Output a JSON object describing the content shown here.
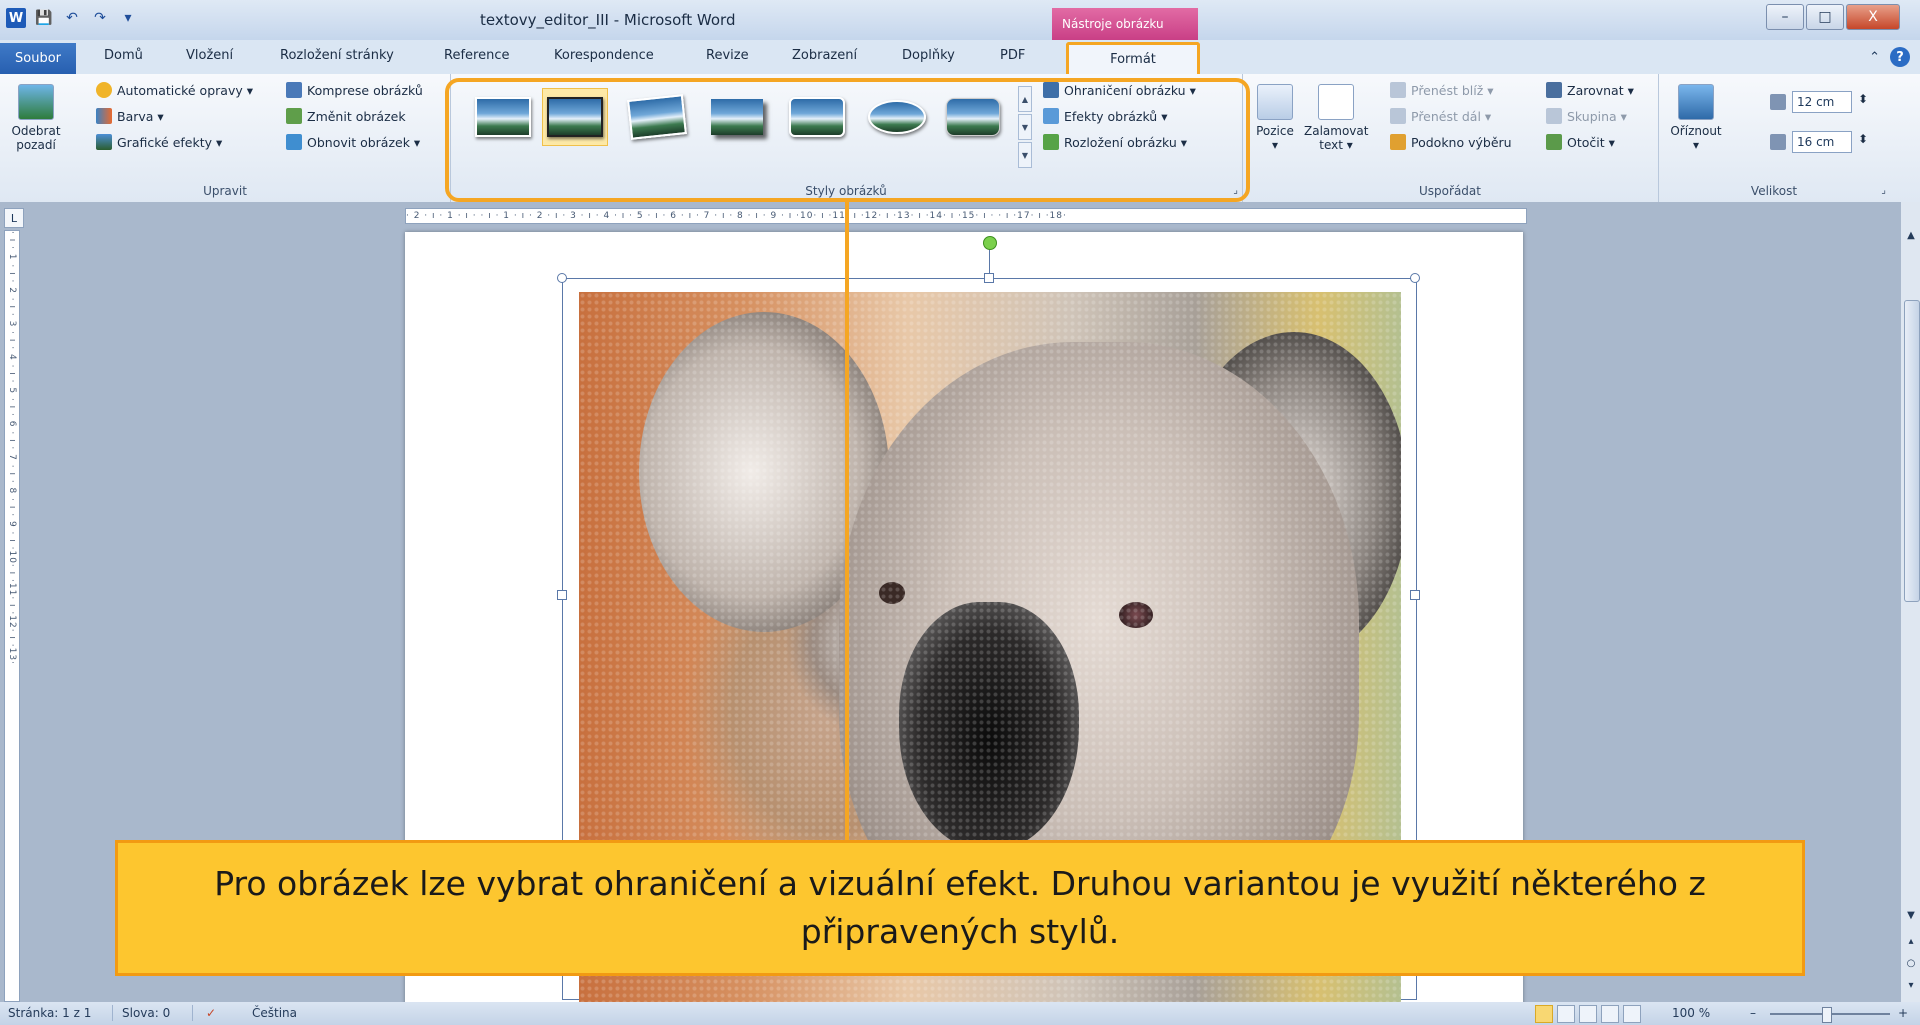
{
  "window": {
    "title": "textovy_editor_III - Microsoft Word",
    "context_group": "Nástroje obrázku",
    "controls": {
      "minimize": "–",
      "maximize": "□",
      "close": "X"
    }
  },
  "qat": {
    "app_icon": "W",
    "save": "💾",
    "undo": "↶",
    "redo": "↷",
    "customize": "▾"
  },
  "tabs": {
    "file": "Soubor",
    "items": [
      "Domů",
      "Vložení",
      "Rozložení stránky",
      "Reference",
      "Korespondence",
      "Revize",
      "Zobrazení",
      "Doplňky",
      "PDF"
    ],
    "active": "Formát",
    "minimize": "⌃",
    "help": "?"
  },
  "ribbon": {
    "adjust": {
      "title": "Upravit",
      "remove_bg": [
        "Odebrat",
        "pozadí"
      ],
      "corrections": "Automatické opravy ▾",
      "color": "Barva ▾",
      "artistic": "Grafické efekty ▾",
      "compress": "Komprese obrázků",
      "change": "Změnit obrázek",
      "reset": "Obnovit obrázek ▾"
    },
    "styles": {
      "title": "Styly obrázků",
      "border": "Ohraničení obrázku ▾",
      "effects": "Efekty obrázků ▾",
      "layout": "Rozložení obrázku ▾"
    },
    "arrange": {
      "title": "Uspořádat",
      "position": [
        "Pozice",
        "▾"
      ],
      "wrap": [
        "Zalamovat",
        "text ▾"
      ],
      "bring_forward": "Přenést blíž ▾",
      "send_backward": "Přenést dál ▾",
      "selection_pane": "Podokno výběru",
      "align": "Zarovnat ▾",
      "group": "Skupina ▾",
      "rotate": "Otočit ▾"
    },
    "size": {
      "title": "Velikost",
      "crop": [
        "Oříznout",
        "▾"
      ],
      "height": "12 cm",
      "width": "16 cm"
    }
  },
  "ruler": {
    "horizontal": "· 2 · ı · 1 · ı ·  · ı · 1 · ı · 2 · ı · 3 · ı · 4 · ı · 5 · ı · 6 · ı · 7 · ı · 8 · ı · 9 · ı ·10· ı ·11· ı ·12· ı ·13· ı ·14· ı ·15· ı ·  · ı ·17· ı ·18·",
    "vertical": "· ı · 1 · ı · 2 · ı · 3 · ı · 4 · ı · 5 · ı · 6 · ı · 7 · ı · 8 · ı · 9 · ı ·10· ı ·11· ı ·12· ı ·13·",
    "tab_selector": "L"
  },
  "callout": {
    "text": "Pro obrázek lze vybrat ohraničení a vizuální efekt. Druhou variantou je využití některého z připravených stylů."
  },
  "statusbar": {
    "page": "Stránka: 1 z 1",
    "words": "Slova: 0",
    "language": "Čeština",
    "zoom": "100 %",
    "zoom_out": "–",
    "zoom_in": "+"
  },
  "scrollbar": {
    "up": "▲",
    "down": "▼",
    "prev": "▴",
    "browse": "○",
    "next": "▾"
  }
}
